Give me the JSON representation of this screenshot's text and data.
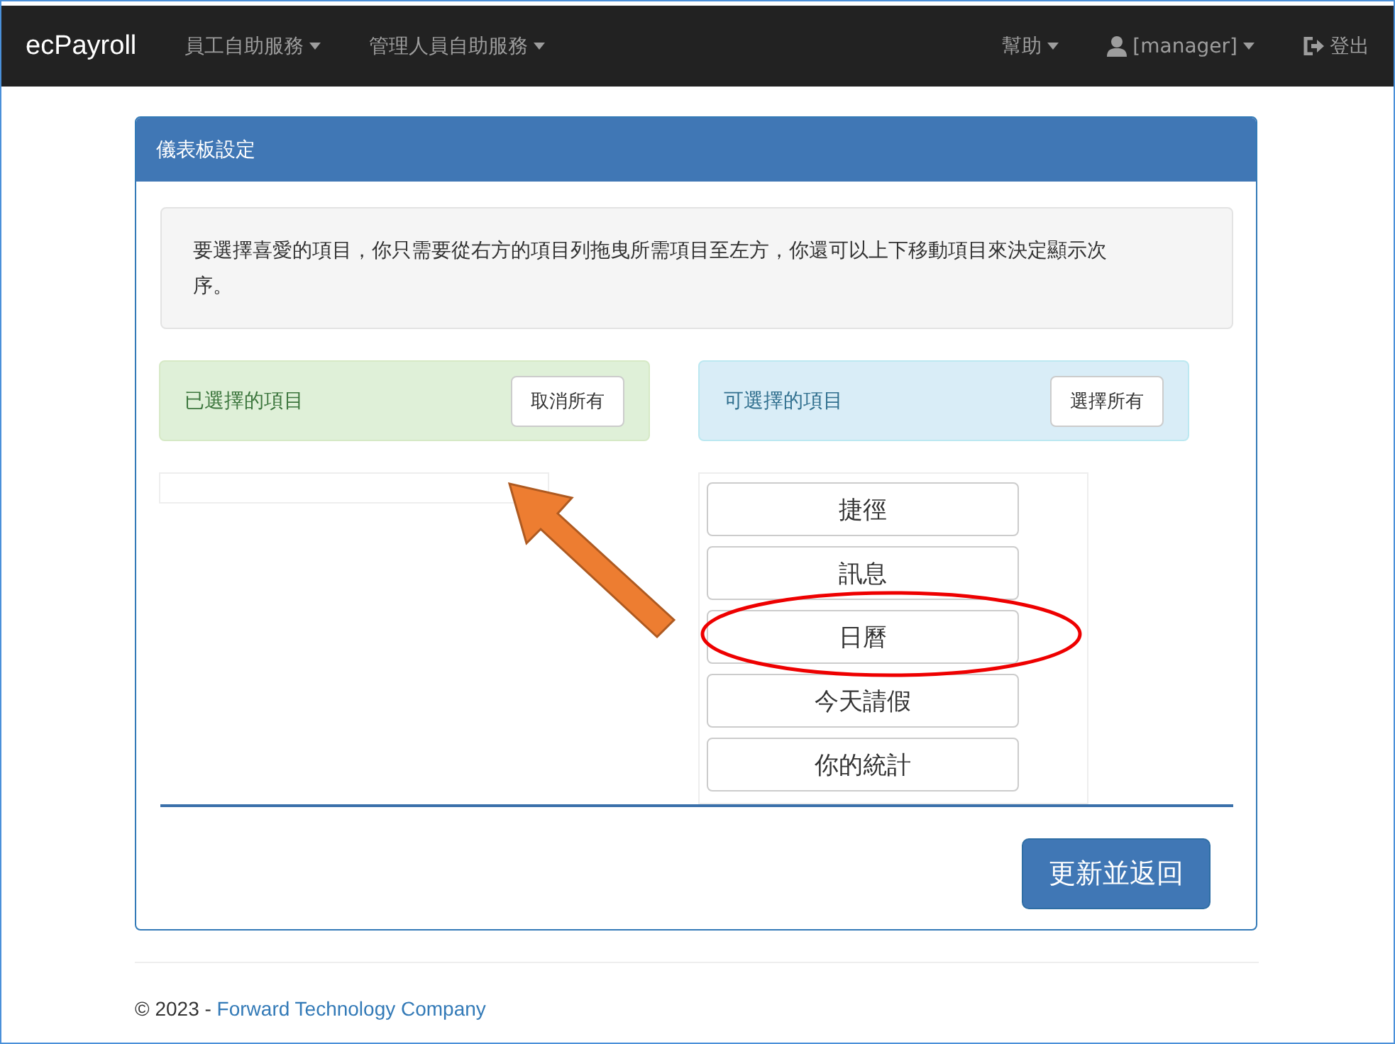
{
  "navbar": {
    "brand": "ecPayroll",
    "menus": [
      {
        "label": "員工自助服務",
        "kind": "dropdown"
      },
      {
        "label": "管理人員自助服務",
        "kind": "dropdown"
      }
    ],
    "right_menus": [
      {
        "label": "幫助",
        "kind": "dropdown"
      },
      {
        "label": "[manager]",
        "kind": "user"
      },
      {
        "label": "登出",
        "kind": "logout"
      }
    ]
  },
  "panel": {
    "title": "儀表板設定",
    "note": "要選擇喜愛的項目，你只需要從右方的項目列拖曳所需項目至左方，你還可以上下移動項目來決定顯示次序。",
    "selected_column": {
      "title": "已選擇的項目",
      "button": "取消所有"
    },
    "available_column": {
      "title": "可選擇的項目",
      "button": "選擇所有",
      "items": [
        "捷徑",
        "訊息",
        "日曆",
        "今天請假",
        "你的統計"
      ]
    },
    "submit": "更新並返回"
  },
  "footer": {
    "copyright": "© 2023 - ",
    "link": "Forward Technology Company"
  }
}
